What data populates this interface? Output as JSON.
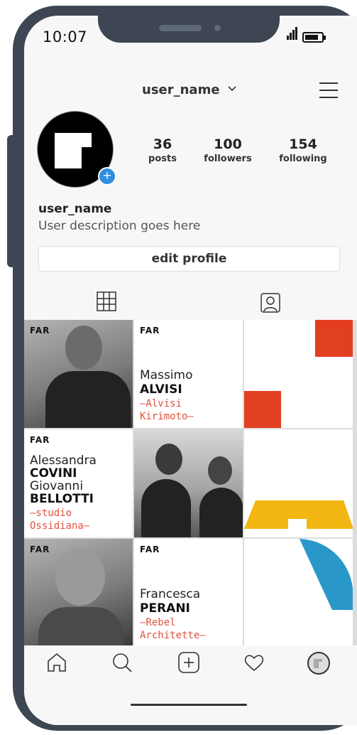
{
  "status_bar": {
    "time": "10:07"
  },
  "header": {
    "username": "user_name",
    "dropdown_icon": "chevron-down-icon",
    "menu_icon": "hamburger-menu-icon"
  },
  "profile": {
    "username": "user_name",
    "description": "User description goes here",
    "edit_button": "edit profile",
    "stats": [
      {
        "value": "36",
        "label": "posts"
      },
      {
        "value": "100",
        "label": "followers"
      },
      {
        "value": "154",
        "label": "following"
      }
    ]
  },
  "tabs": {
    "grid_icon": "grid-icon",
    "tagged_icon": "tagged-person-icon"
  },
  "posts": {
    "far": "FAR",
    "p2": {
      "first": "Massimo",
      "last": "ALVISI",
      "studio1": "—Alvisi",
      "studio2": "Kirimoto—"
    },
    "p4": {
      "first1": "Alessandra",
      "last1": "COVINI",
      "first2": "Giovanni",
      "last2": "BELLOTTI",
      "studio1": "—studio",
      "studio2": "Ossidiana—"
    },
    "p8": {
      "first": "Francesca",
      "last": "PERANI",
      "studio1": "—Rebel",
      "studio2": "Architette—"
    }
  },
  "bottom_nav": [
    "home-icon",
    "search-icon",
    "add-post-icon",
    "heart-icon",
    "profile-avatar-icon"
  ],
  "colors": {
    "red": "#e23e22",
    "yellow": "#f3b713",
    "blue": "#2a97c9",
    "accent": "#2e8ee0"
  }
}
